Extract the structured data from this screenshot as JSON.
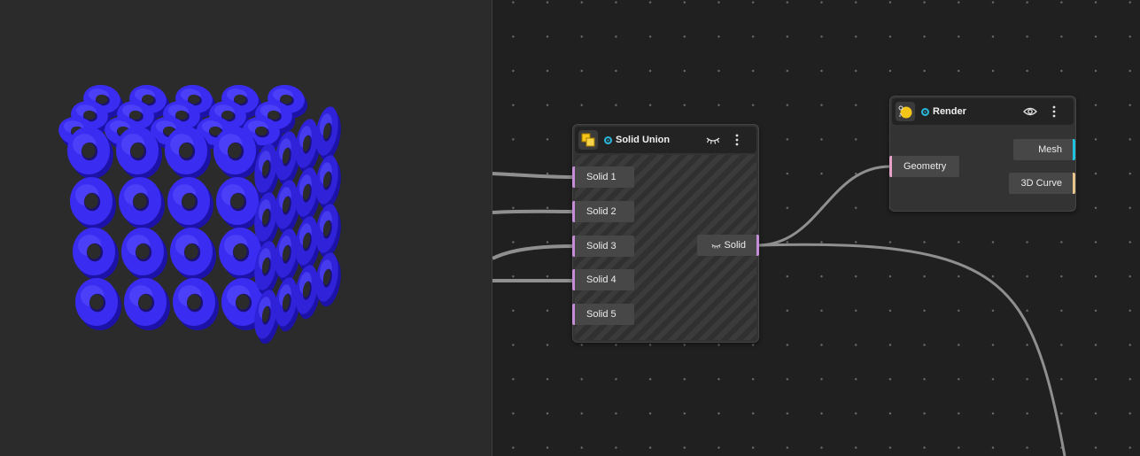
{
  "viewport": {
    "object": "blue-torus-lattice-cube",
    "color": "#3a2cf0"
  },
  "graph": {
    "nodes": {
      "solid_union": {
        "title": "Solid Union",
        "icon": "solid-union-icon",
        "visibility_icon": "eye-closed-icon",
        "menu_icon": "kebab-menu-icon",
        "inputs": [
          "Solid 1",
          "Solid 2",
          "Solid 3",
          "Solid 4",
          "Solid 5"
        ],
        "output": "Solid",
        "output_icon": "eye-closed-icon"
      },
      "render": {
        "title": "Render",
        "icon": "render-icon",
        "visibility_icon": "eye-open-icon",
        "menu_icon": "kebab-menu-icon",
        "input": "Geometry",
        "outputs": [
          "Mesh",
          "3D Curve"
        ]
      }
    },
    "colors": {
      "solid_port": "#c58dd6",
      "geometry_port": "#e6a3c6",
      "mesh_port": "#1fc3e0",
      "curve_port": "#e8c48d",
      "status": "#29b6d8",
      "wire": "#8f8f8f"
    }
  }
}
